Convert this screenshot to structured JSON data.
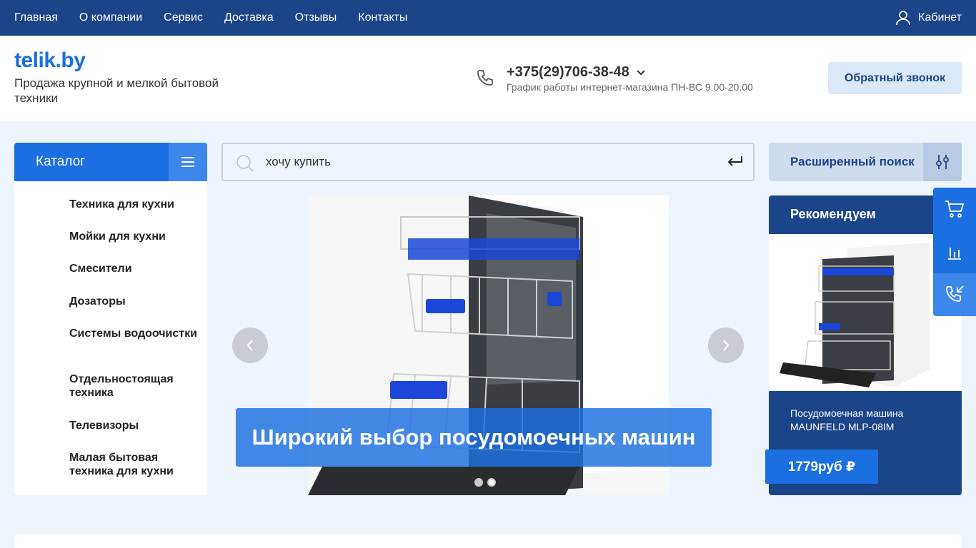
{
  "topnav": {
    "items": [
      "Главная",
      "О компании",
      "Сервис",
      "Доставка",
      "Отзывы",
      "Контакты"
    ],
    "cabinet": "Кабинет"
  },
  "header": {
    "logo": "telik.by",
    "tagline": "Продажа крупной и мелкой бытовой техники",
    "phone": "+375(29)706-38-48",
    "hours": "График работы интернет-магазина ПН-ВС 9.00-20.00",
    "callback": "Обратный звонок"
  },
  "catalog": {
    "title": "Каталог",
    "items": [
      "Техника для кухни",
      "Мойки для кухни",
      "Смесители",
      "Дозаторы",
      "Системы водоочистки",
      "Отдельностоящая техника",
      "Телевизоры",
      "Малая бытовая техника для кухни"
    ]
  },
  "search": {
    "value": "хочу купить",
    "advanced": "Расширенный поиск"
  },
  "slider": {
    "caption": "Широкий выбор посудомоечных машин"
  },
  "recommend": {
    "title": "Рекомендуем",
    "product": "Посудомоечная машина MAUNFELD MLP-08IM",
    "price": "1779руб ₽"
  },
  "colors": {
    "navy": "#1a4588",
    "blue": "#1b6fe0",
    "light": "#edf4fc"
  }
}
